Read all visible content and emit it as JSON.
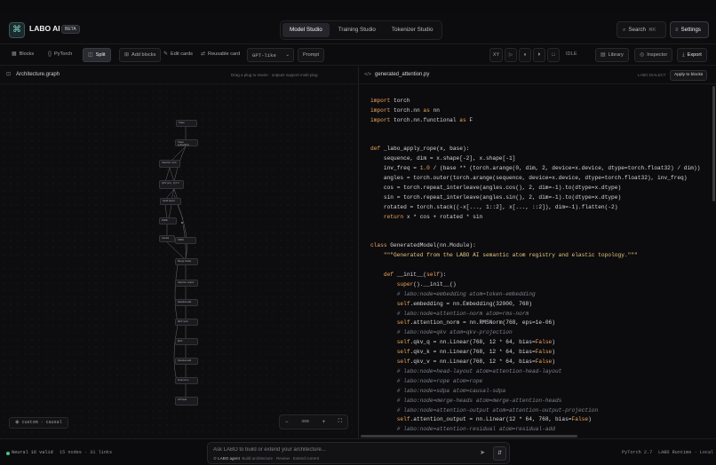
{
  "header": {
    "brand": "LABO AI",
    "badge": "BETA",
    "tabs": [
      {
        "label": "Model Studio",
        "active": true
      },
      {
        "label": "Training Studio",
        "active": false
      },
      {
        "label": "Tokenizer Studio",
        "active": false
      }
    ],
    "search_label": "Search",
    "search_shortcut": "⌘K",
    "settings_label": "Settings"
  },
  "toolbar": {
    "blocks": "Blocks",
    "pytorch": "PyTorch",
    "split": "Split",
    "add_blocks": "Add blocks",
    "edit_cards": "Edit cards",
    "reusable_card": "Reusable card",
    "preset": "GPT-like",
    "prompt": "Prompt",
    "xy": "XY",
    "state": "IDLE",
    "library": "Library",
    "inspector": "Inspector",
    "export": "Export"
  },
  "graph_panel": {
    "title": "Architecture.graph",
    "hint": "Drag a plug to rewire · outputs support multi-plug",
    "arch_label": "custom · causal",
    "zoom": "35%"
  },
  "code_panel": {
    "file": "generated_attention.py",
    "dialect": "LABO DIALECT",
    "apply": "Apply to blocks",
    "lines": [
      [
        [
          "kw",
          "import"
        ],
        [
          "t",
          " torch"
        ]
      ],
      [
        [
          "kw",
          "import"
        ],
        [
          "t",
          " torch.nn "
        ],
        [
          "kw",
          "as"
        ],
        [
          "t",
          " nn"
        ]
      ],
      [
        [
          "kw",
          "import"
        ],
        [
          "t",
          " torch.nn.functional "
        ],
        [
          "kw",
          "as"
        ],
        [
          "t",
          " F"
        ]
      ],
      [],
      [],
      [
        [
          "kw",
          "def"
        ],
        [
          "t",
          " _labo_apply_rope(x, base):"
        ]
      ],
      [
        [
          "t",
          "    sequence, dim = x.shape[-2], x.shape[-1]"
        ]
      ],
      [
        [
          "t",
          "    inv_freq = "
        ],
        [
          "kw",
          "1.0"
        ],
        [
          "t",
          " / (base ** (torch.arange(0, dim, 2, device=x.device, dtype=torch.float32) / dim))"
        ]
      ],
      [
        [
          "t",
          "    angles = torch.outer(torch.arange(sequence, device=x.device, dtype=torch.float32), inv_freq)"
        ]
      ],
      [
        [
          "t",
          "    cos = torch.repeat_interleave(angles.cos(), 2, dim=-1).to(dtype=x.dtype)"
        ]
      ],
      [
        [
          "t",
          "    sin = torch.repeat_interleave(angles.sin(), 2, dim=-1).to(dtype=x.dtype)"
        ]
      ],
      [
        [
          "t",
          "    rotated = torch.stack((-x[..., 1::2], x[..., ::2]), dim=-1).flatten(-2)"
        ]
      ],
      [
        [
          "t",
          "    "
        ],
        [
          "kw",
          "return"
        ],
        [
          "t",
          " x * cos + rotated * sin"
        ]
      ],
      [],
      [],
      [
        [
          "kw",
          "class"
        ],
        [
          "t",
          " GeneratedModel(nn.Module):"
        ]
      ],
      [
        [
          "t",
          "    "
        ],
        [
          "str",
          "\"\"\"Generated from the LABO AI semantic atom registry and elastic topology.\"\"\""
        ]
      ],
      [],
      [
        [
          "t",
          "    "
        ],
        [
          "kw",
          "def"
        ],
        [
          "t",
          " __init__("
        ],
        [
          "kw",
          "self"
        ],
        [
          "t",
          "):"
        ]
      ],
      [
        [
          "t",
          "        "
        ],
        [
          "kw",
          "super"
        ],
        [
          "t",
          "().__init__()"
        ]
      ],
      [
        [
          "t",
          "        "
        ],
        [
          "cm",
          "# labo:node=embedding atom=token-embedding"
        ]
      ],
      [
        [
          "t",
          "        "
        ],
        [
          "kw",
          "self"
        ],
        [
          "t",
          ".embedding = nn.Embedding(32000, 768)"
        ]
      ],
      [
        [
          "t",
          "        "
        ],
        [
          "cm",
          "# labo:node=attention-norm atom=rms-norm"
        ]
      ],
      [
        [
          "t",
          "        "
        ],
        [
          "kw",
          "self"
        ],
        [
          "t",
          ".attention_norm = nn.RMSNorm(768, eps=1e-06)"
        ]
      ],
      [
        [
          "t",
          "        "
        ],
        [
          "cm",
          "# labo:node=qkv atom=qkv-projection"
        ]
      ],
      [
        [
          "t",
          "        "
        ],
        [
          "kw",
          "self"
        ],
        [
          "t",
          ".qkv_q = nn.Linear(768, 12 * 64, bias="
        ],
        [
          "kw",
          "False"
        ],
        [
          "t",
          ")"
        ]
      ],
      [
        [
          "t",
          "        "
        ],
        [
          "kw",
          "self"
        ],
        [
          "t",
          ".qkv_k = nn.Linear(768, 12 * 64, bias="
        ],
        [
          "kw",
          "False"
        ],
        [
          "t",
          ")"
        ]
      ],
      [
        [
          "t",
          "        "
        ],
        [
          "kw",
          "self"
        ],
        [
          "t",
          ".qkv_v = nn.Linear(768, 12 * 64, bias="
        ],
        [
          "kw",
          "False"
        ],
        [
          "t",
          ")"
        ]
      ],
      [
        [
          "t",
          "        "
        ],
        [
          "cm",
          "# labo:node=head-layout atom=attention-head-layout"
        ]
      ],
      [
        [
          "t",
          "        "
        ],
        [
          "cm",
          "# labo:node=rope atom=rope"
        ]
      ],
      [
        [
          "t",
          "        "
        ],
        [
          "cm",
          "# labo:node=sdpa atom=causal-sdpa"
        ]
      ],
      [
        [
          "t",
          "        "
        ],
        [
          "cm",
          "# labo:node=merge-heads atom=merge-attention-heads"
        ]
      ],
      [
        [
          "t",
          "        "
        ],
        [
          "cm",
          "# labo:node=attention-output atom=attention-output-projection"
        ]
      ],
      [
        [
          "t",
          "        "
        ],
        [
          "kw",
          "self"
        ],
        [
          "t",
          ".attention_output = nn.Linear(12 * 64, 768, bias="
        ],
        [
          "kw",
          "False"
        ],
        [
          "t",
          ")"
        ]
      ],
      [
        [
          "t",
          "        "
        ],
        [
          "cm",
          "# labo:node=attention-residual atom=residual-add"
        ]
      ]
    ]
  },
  "status": {
    "neural": "Neural 16 valid",
    "counts": "15 nodes · 31 links",
    "chat_placeholder": "Ask LABO to build or extend your architecture...",
    "agent_name": "LABO agent",
    "agent_hints": "Build architecture · Review · Extend current",
    "pytorch_version": "PyTorch 2.7",
    "runtime": "LABO Runtime · Local"
  },
  "colors": {
    "accent_keyword": "#f0a65e",
    "comment": "#7e8190",
    "ok": "#4cc38a"
  }
}
